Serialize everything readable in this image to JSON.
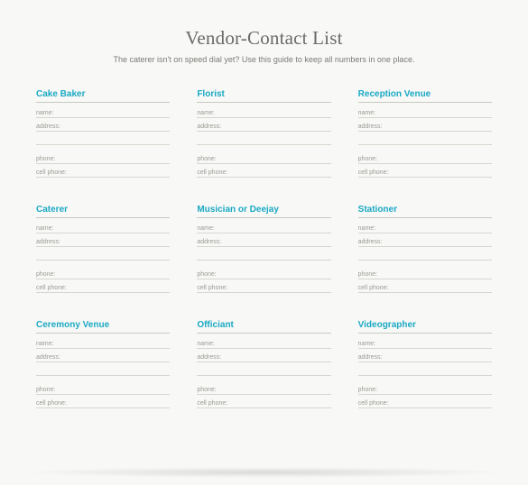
{
  "header": {
    "title": "Vendor-Contact List",
    "subtitle": "The caterer isn't on speed dial yet? Use this guide to keep all numbers in one place."
  },
  "labels": {
    "name": "name:",
    "address": "address:",
    "phone": "phone:",
    "cellphone": "cell phone:"
  },
  "vendors": [
    {
      "title": "Cake Baker"
    },
    {
      "title": "Florist"
    },
    {
      "title": "Reception Venue"
    },
    {
      "title": "Caterer"
    },
    {
      "title": "Musician or Deejay"
    },
    {
      "title": "Stationer"
    },
    {
      "title": "Ceremony Venue"
    },
    {
      "title": "Officiant"
    },
    {
      "title": "Videographer"
    }
  ],
  "colors": {
    "accent": "#1aa9c4",
    "text_muted": "#9a9a94",
    "title_gray": "#6a6a68",
    "line": "#d6d6d0",
    "bg": "#f8f8f6"
  }
}
